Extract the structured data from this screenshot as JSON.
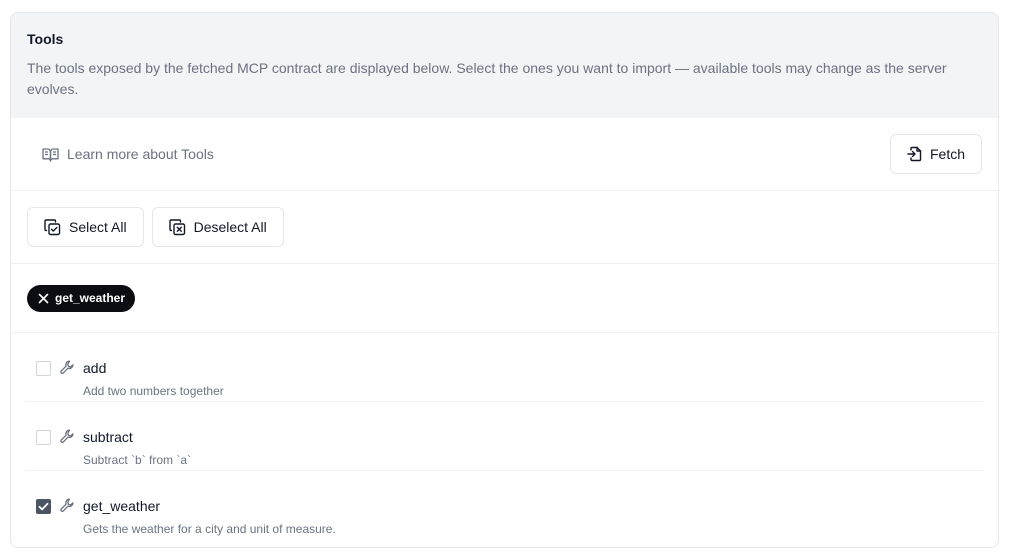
{
  "header": {
    "title": "Tools",
    "description": "The tools exposed by the fetched MCP contract are displayed below. Select the ones you want to import — available tools may change as the server evolves."
  },
  "learn_more": {
    "label": "Learn more about Tools",
    "icon": "book-open-icon"
  },
  "fetch_button": {
    "label": "Fetch",
    "icon": "file-import-icon"
  },
  "select_all_button": {
    "label": "Select All",
    "icon": "copy-check-icon"
  },
  "deselect_all_button": {
    "label": "Deselect All",
    "icon": "copy-x-icon"
  },
  "selected_chips": [
    {
      "label": "get_weather",
      "icon": "close-icon"
    }
  ],
  "tools": [
    {
      "name": "add",
      "description": "Add two numbers together",
      "checked": false,
      "icon": "wrench-icon"
    },
    {
      "name": "subtract",
      "description": "Subtract `b` from `a`",
      "checked": false,
      "icon": "wrench-icon"
    },
    {
      "name": "get_weather",
      "description": "Gets the weather for a city and unit of measure.",
      "checked": true,
      "icon": "wrench-icon"
    }
  ],
  "colors": {
    "chip_bg": "#0b0d12",
    "header_bg": "#f3f4f6",
    "muted_text": "#6b7280",
    "checkbox_checked": "#4b5563"
  }
}
